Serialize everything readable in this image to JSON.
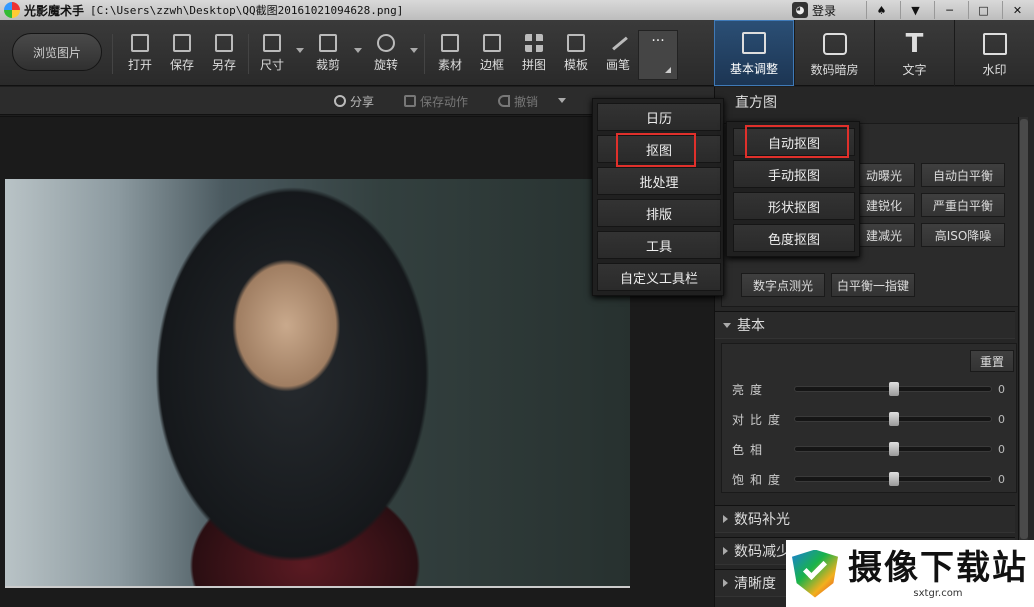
{
  "titlebar": {
    "app_name": "光影魔术手",
    "path": "[C:\\Users\\zzwh\\Desktop\\QQ截图20161021094628.png]",
    "login_label": "登录",
    "login_icon": "chat-face-icon",
    "buttons": [
      "shirt-icon",
      "chevron-down-icon",
      "minimize-icon",
      "maximize-icon",
      "close-icon"
    ],
    "button_glyphs": [
      "♠",
      "▼",
      "─",
      "□",
      "✕"
    ]
  },
  "toolbar": {
    "browse_label": "浏览图片",
    "tools": [
      {
        "label": "打开",
        "icon": "open-icon"
      },
      {
        "label": "保存",
        "icon": "save-icon"
      },
      {
        "label": "另存",
        "icon": "save-as-icon"
      },
      {
        "label": "尺寸",
        "icon": "resize-icon"
      },
      {
        "label": "裁剪",
        "icon": "crop-icon"
      },
      {
        "label": "旋转",
        "icon": "rotate-icon"
      },
      {
        "label": "素材",
        "icon": "star-icon"
      },
      {
        "label": "边框",
        "icon": "frame-icon"
      },
      {
        "label": "拼图",
        "icon": "grid-icon"
      },
      {
        "label": "模板",
        "icon": "printer-icon"
      },
      {
        "label": "画笔",
        "icon": "pen-icon"
      }
    ],
    "more_label": "···",
    "tabs": [
      {
        "label": "基本调整",
        "icon": "edit-icon",
        "active": true
      },
      {
        "label": "数码暗房",
        "icon": "camera-icon",
        "active": false
      },
      {
        "label": "文字",
        "icon": "text-icon",
        "glyph": "T",
        "active": false
      },
      {
        "label": "水印",
        "icon": "watermark-icon",
        "active": false
      }
    ]
  },
  "subbar": {
    "share_label": "分享",
    "save_action_label": "保存动作",
    "undo_label": "撤销"
  },
  "dropdown_more": {
    "items": [
      "日历",
      "抠图",
      "批处理",
      "排版",
      "工具",
      "自定义工具栏"
    ],
    "highlighted": "抠图"
  },
  "dropdown_cutout": {
    "items": [
      "自动抠图",
      "手动抠图",
      "形状抠图",
      "色度抠图"
    ],
    "highlighted": "自动抠图"
  },
  "panel": {
    "histogram_title": "直方图",
    "quick_buttons": [
      [
        "动曝光",
        "自动白平衡"
      ],
      [
        "建锐化",
        "严重白平衡"
      ],
      [
        "建减光",
        "高ISO降噪"
      ]
    ],
    "extra_buttons": [
      "数字点测光",
      "白平衡一指键"
    ],
    "basic_section": "基本",
    "reset_label": "重置",
    "sliders": [
      {
        "label": "亮度",
        "value": "0",
        "fraction": 0.5
      },
      {
        "label": "对比度",
        "value": "0",
        "fraction": 0.5
      },
      {
        "label": "色相",
        "value": "0",
        "fraction": 0.5
      },
      {
        "label": "饱和度",
        "value": "0",
        "fraction": 0.5
      }
    ],
    "collapsed_sections": [
      "数码补光",
      "数码减少",
      "清晰度"
    ]
  },
  "watermark": {
    "title": "摄像下载站",
    "url": "sxtgr.com"
  }
}
